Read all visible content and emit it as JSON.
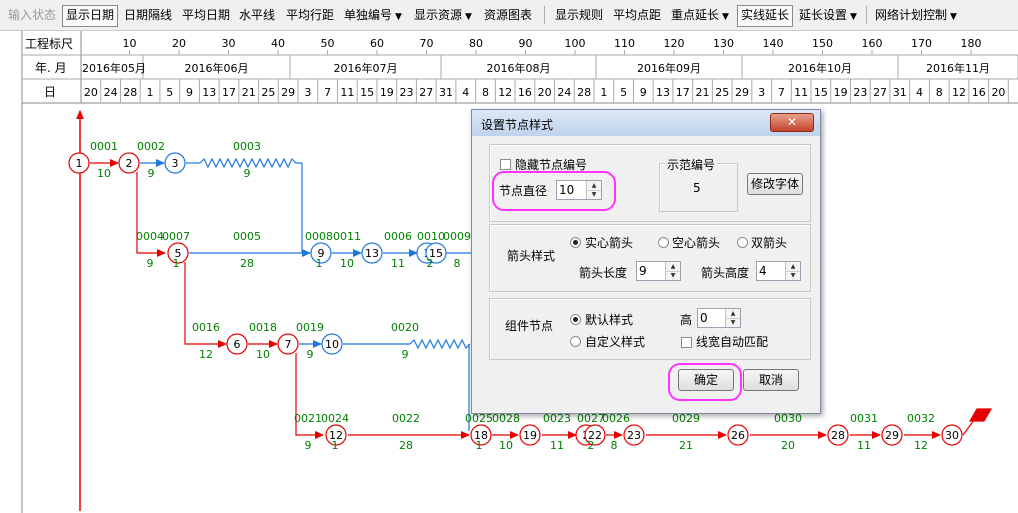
{
  "toolbar": {
    "input_state": "输入状态",
    "show_date": "显示日期",
    "date_gridlines": "日期隔线",
    "average_date": "平均日期",
    "horizontal_line": "水平线",
    "average_row_spacing": "平均行距",
    "single_number": "单独编号",
    "show_resources": "显示资源",
    "resource_chart": "资源图表",
    "show_rules": "显示规则",
    "average_node_spacing": "平均点距",
    "focus_extension": "重点延长",
    "solid_extension": "实线延长",
    "extension_settings": "延长设置",
    "network_plan_control": "网络计划控制"
  },
  "timescale": {
    "row_labels": {
      "scale": "工程标尺",
      "month": "年. 月",
      "day": "日"
    },
    "scale_ticks": [
      "10",
      "20",
      "30",
      "40",
      "50",
      "60",
      "70",
      "80",
      "90",
      "100",
      "110",
      "120",
      "130",
      "140",
      "150",
      "160",
      "170",
      "180"
    ],
    "months": [
      "2016年05月",
      "2016年06月",
      "2016年07月",
      "2016年08月",
      "2016年09月",
      "2016年10月",
      "2016年11月"
    ],
    "days": [
      "20",
      "24",
      "28",
      "1",
      "5",
      "9",
      "13",
      "17",
      "21",
      "25",
      "29",
      "3",
      "7",
      "11",
      "15",
      "19",
      "23",
      "27",
      "31",
      "4",
      "8",
      "12",
      "16",
      "20",
      "24",
      "28",
      "1",
      "5",
      "9",
      "13",
      "17",
      "21",
      "25",
      "29",
      "3",
      "7",
      "11",
      "15",
      "19",
      "23",
      "27",
      "31",
      "4",
      "8",
      "12",
      "16",
      "20"
    ]
  },
  "network": {
    "nodes": [
      {
        "id": "1",
        "color": "red"
      },
      {
        "id": "2",
        "color": "red"
      },
      {
        "id": "3",
        "color": "blue"
      },
      {
        "id": "5",
        "color": "red"
      },
      {
        "id": "9",
        "color": "blue"
      },
      {
        "id": "13",
        "color": "blue"
      },
      {
        "id": "1",
        "color": "blue"
      },
      {
        "id": "15",
        "color": "blue"
      },
      {
        "id": "6",
        "color": "red"
      },
      {
        "id": "7",
        "color": "red"
      },
      {
        "id": "10",
        "color": "blue"
      },
      {
        "id": "12",
        "color": "red"
      },
      {
        "id": "18",
        "color": "red"
      },
      {
        "id": "19",
        "color": "red"
      },
      {
        "id": "2",
        "color": "red"
      },
      {
        "id": "22",
        "color": "red"
      },
      {
        "id": "23",
        "color": "red"
      },
      {
        "id": "26",
        "color": "red"
      },
      {
        "id": "28",
        "color": "red"
      },
      {
        "id": "29",
        "color": "red"
      },
      {
        "id": "30",
        "color": "red"
      }
    ],
    "activity_codes": [
      "0001",
      "0002",
      "0003",
      "0004",
      "0007",
      "0005",
      "0008",
      "0011",
      "0006",
      "0010",
      "0009",
      "0016",
      "0018",
      "0019",
      "0020",
      "0021",
      "0024",
      "0022",
      "0025",
      "0028",
      "0023",
      "0027",
      "0026",
      "0029",
      "0030",
      "0031",
      "0032"
    ],
    "durations": [
      "10",
      "9",
      "9",
      "9",
      "1",
      "28",
      "1",
      "10",
      "11",
      "2",
      "8",
      "12",
      "10",
      "9",
      "9",
      "9",
      "1",
      "28",
      "1",
      "10",
      "11",
      "2",
      "8",
      "21",
      "20",
      "11",
      "12"
    ]
  },
  "dialog": {
    "title": "设置节点样式",
    "close_glyph": "✕",
    "hide_node_number": "隐藏节点编号",
    "sample_number_label": "示范编号",
    "sample_number_value": "5",
    "node_diameter_label": "节点直径",
    "node_diameter_value": "10",
    "change_font": "修改字体",
    "arrow_style_label": "箭头样式",
    "solid_arrow": "实心箭头",
    "hollow_arrow": "空心箭头",
    "double_arrow": "双箭头",
    "arrow_length_label": "箭头长度",
    "arrow_length_value": "9",
    "arrow_height_label": "箭头高度",
    "arrow_height_value": "4",
    "group_node_label": "组件节点",
    "default_style": "默认样式",
    "custom_style": "自定义样式",
    "height_label": "高",
    "height_value": "0",
    "auto_match_width": "线宽自动匹配",
    "ok": "确定",
    "cancel": "取消"
  },
  "colors": {
    "critical": "#e60000",
    "normal": "#1e78dc",
    "label": "#008000",
    "highlight": "#ff33ff"
  }
}
